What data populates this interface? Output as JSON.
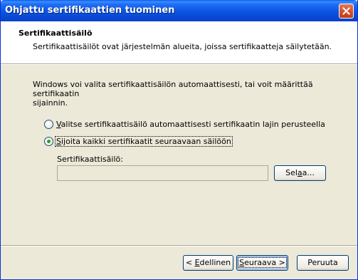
{
  "window": {
    "title": "Ohjattu sertifikaattien tuominen",
    "colors": {
      "titlebar": "#0a54e3",
      "dialog_bg": "#ece9d8",
      "header_bg": "#ffffff",
      "close_button": "#d8522e",
      "radio_dot": "#21a121"
    }
  },
  "header": {
    "title": "Sertifikaattisäilö",
    "subtitle": "Sertifikaattisäilöt ovat järjestelmän alueita, joissa sertifikaatteja säilytetään."
  },
  "body": {
    "intro_line1": "Windows voi valita sertifikaattisäilön automaattisesti, tai voit määrittää sertifikaatin",
    "intro_line2": "sijainnin.",
    "option_auto": {
      "label_key": "V",
      "label_rest": "alitse sertifikaattisäilö automaattisesti sertifikaatin lajin perusteella",
      "selected": false
    },
    "option_manual": {
      "label_key": "S",
      "label_rest": "ijoita kaikki sertifikaatit seuraavaan säilöön",
      "selected": true
    },
    "store_label": "Sertifikaattisäilö:",
    "store_value": "",
    "browse": {
      "pre": "Sel",
      "key": "a",
      "post": "a..."
    }
  },
  "footer": {
    "back": {
      "pre": "< ",
      "key": "E",
      "post": "dellinen"
    },
    "next": {
      "pre": "",
      "key": "S",
      "post": "euraava >"
    },
    "cancel": "Peruuta"
  },
  "icons": {
    "close": "close-icon"
  }
}
